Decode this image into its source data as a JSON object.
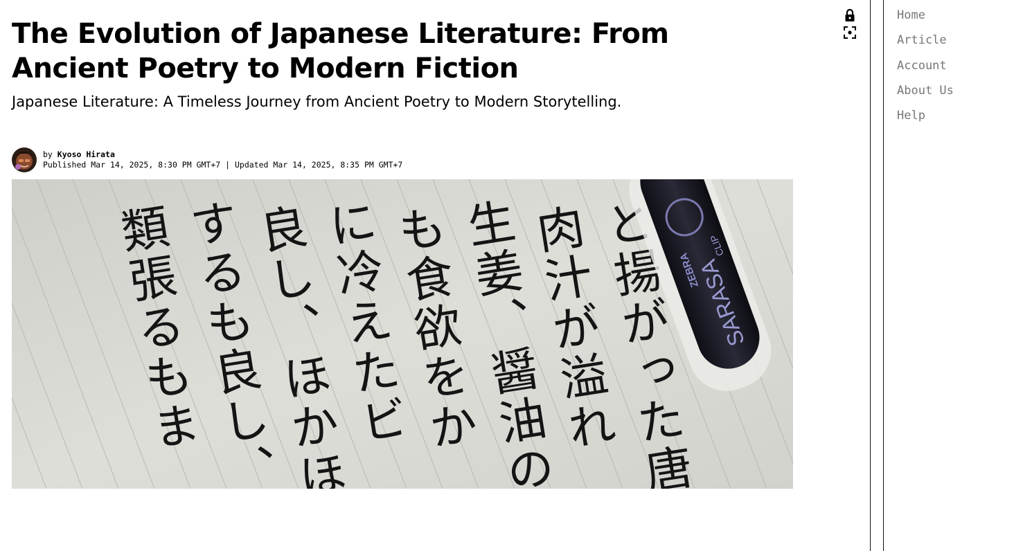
{
  "article": {
    "title": "The Evolution of Japanese Literature: From Ancient Poetry to Modern Fiction",
    "subtitle": "Japanese Literature: A Timeless Journey from Ancient Poetry to Modern Storytelling.",
    "byline_prefix": "by",
    "author": "Kyoso Hirata",
    "published_label": "Published",
    "published": "Mar 14, 2025, 8:30 PM GMT+7",
    "separator": "|",
    "updated_label": "Updated",
    "updated": "Mar 14, 2025, 8:35 PM GMT+7"
  },
  "hero_image": {
    "pen_brand": "ZEBRA",
    "pen_model": "SARASA",
    "pen_clip": "CLIP",
    "handwriting_columns": [
      "と揚がった唐",
      "肉汁が溢れ",
      "生姜、醤油の",
      "も食欲をか",
      "に冷えたビ",
      "良し、ほかほか",
      "するも良し、",
      "類張るもま"
    ]
  },
  "toolbar": {
    "lock_icon": "lock-icon",
    "focus_icon": "focus-icon"
  },
  "nav": {
    "items": [
      "Home",
      "Article",
      "Account",
      "About Us",
      "Help"
    ]
  },
  "colors": {
    "nav_text": "#777777",
    "paper": "#d6d6d1",
    "ink": "#141414",
    "pen_body": "#1b1b24"
  }
}
